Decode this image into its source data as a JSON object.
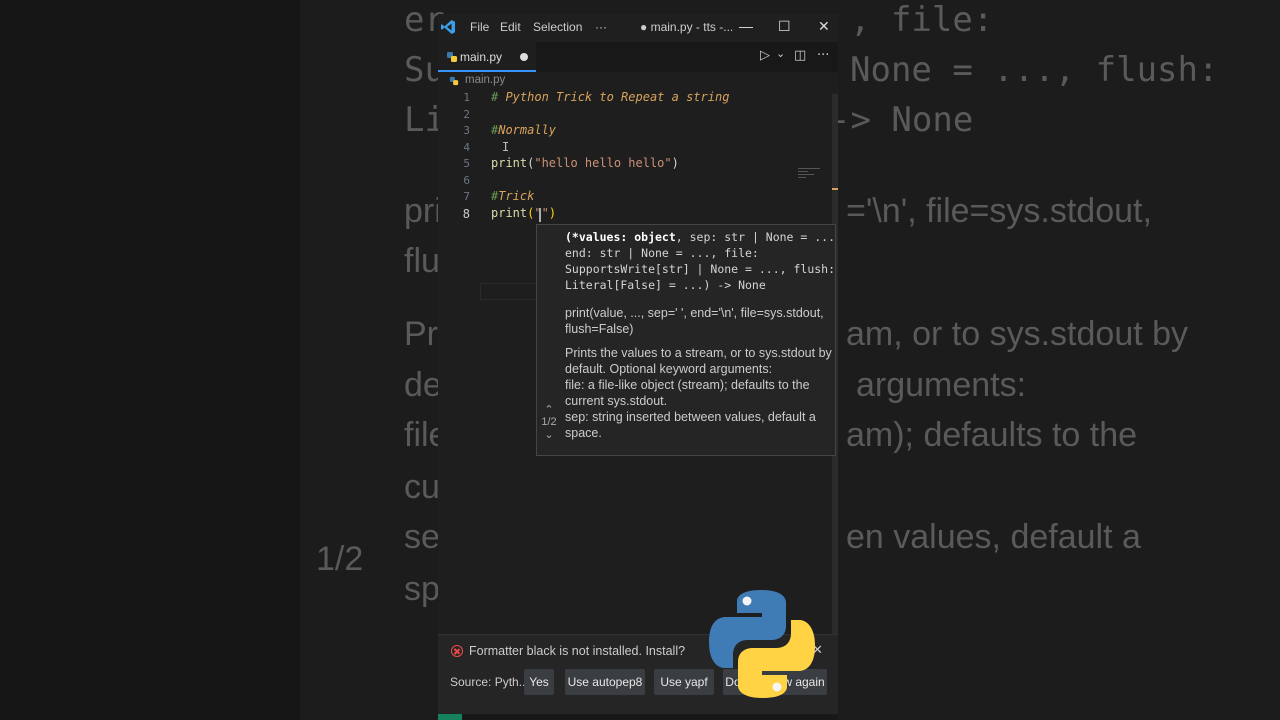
{
  "background": {
    "rows": [
      "end: str | None = ..., file:",
      "SupportsWrite[str] | None = ..., flush:",
      "Literal[False] = ...) -> None",
      "print(value, ..., sep=' ', end='\\n', file=sys.stdout,",
      "flush=False)",
      "Prints the values to a stream, or to sys.stdout by",
      "default. Optional keyword arguments:",
      "file: a file-like object (stream); defaults to the",
      "current sys.stdout.",
      "sep: string inserted between values, default a",
      "space."
    ],
    "pager": "1/2"
  },
  "titlebar": {
    "menu": [
      "File",
      "Edit",
      "Selection",
      "···"
    ],
    "title": "● main.py - tts -...",
    "controls": [
      "—",
      "☐",
      "✕"
    ]
  },
  "tab": {
    "label": "main.py"
  },
  "tab_controls": {
    "run": "▷",
    "run_menu": "⌄",
    "split": "◫",
    "more": "···"
  },
  "breadcrumb": {
    "file": "main.py"
  },
  "editor": {
    "lines": [
      {
        "num": "1",
        "hash": "#",
        "comment": " Python Trick to Repeat a string"
      },
      {
        "num": "2"
      },
      {
        "num": "3",
        "hash": "#",
        "comment": "Normally"
      },
      {
        "num": "4"
      },
      {
        "num": "5",
        "fn": "print",
        "open": "(",
        "str": "\"hello hello hello\"",
        "close": ")"
      },
      {
        "num": "6"
      },
      {
        "num": "7",
        "hash": "#",
        "comment": "Trick"
      },
      {
        "num": "8",
        "fn": "print",
        "open": "(",
        "str": "\"\"",
        "close": ")"
      }
    ]
  },
  "hover": {
    "sig_bold": "(*values: object",
    "sig_rest": ", sep: str | None = ...,\nend: str | None = ..., file:\nSupportsWrite[str] | None = ..., flush:\nLiteral[False] = ...) -> None",
    "usage": "print(value, ..., sep=' ', end='\\n', file=sys.stdout, flush=False)",
    "doc1": "Prints the values to a stream, or to sys.stdout by default. Optional keyword arguments:",
    "doc2": "file: a file-like object (stream); defaults to the current sys.stdout.",
    "doc3": "sep: string inserted between values, default a space.",
    "pager_up": "⌃",
    "pager": "1/2",
    "pager_down": "⌄"
  },
  "notification": {
    "message": "Formatter black is not installed. Install?",
    "close": "✕",
    "source": "Source: Pyth...",
    "buttons": [
      "Yes",
      "Use autopep8",
      "Use yapf",
      "Do not show again"
    ]
  },
  "colors": {
    "accent": "#3794ff",
    "comment": "#d7a35c",
    "function": "#dcdcaa",
    "string": "#ce9178",
    "error": "#f14c4c"
  }
}
